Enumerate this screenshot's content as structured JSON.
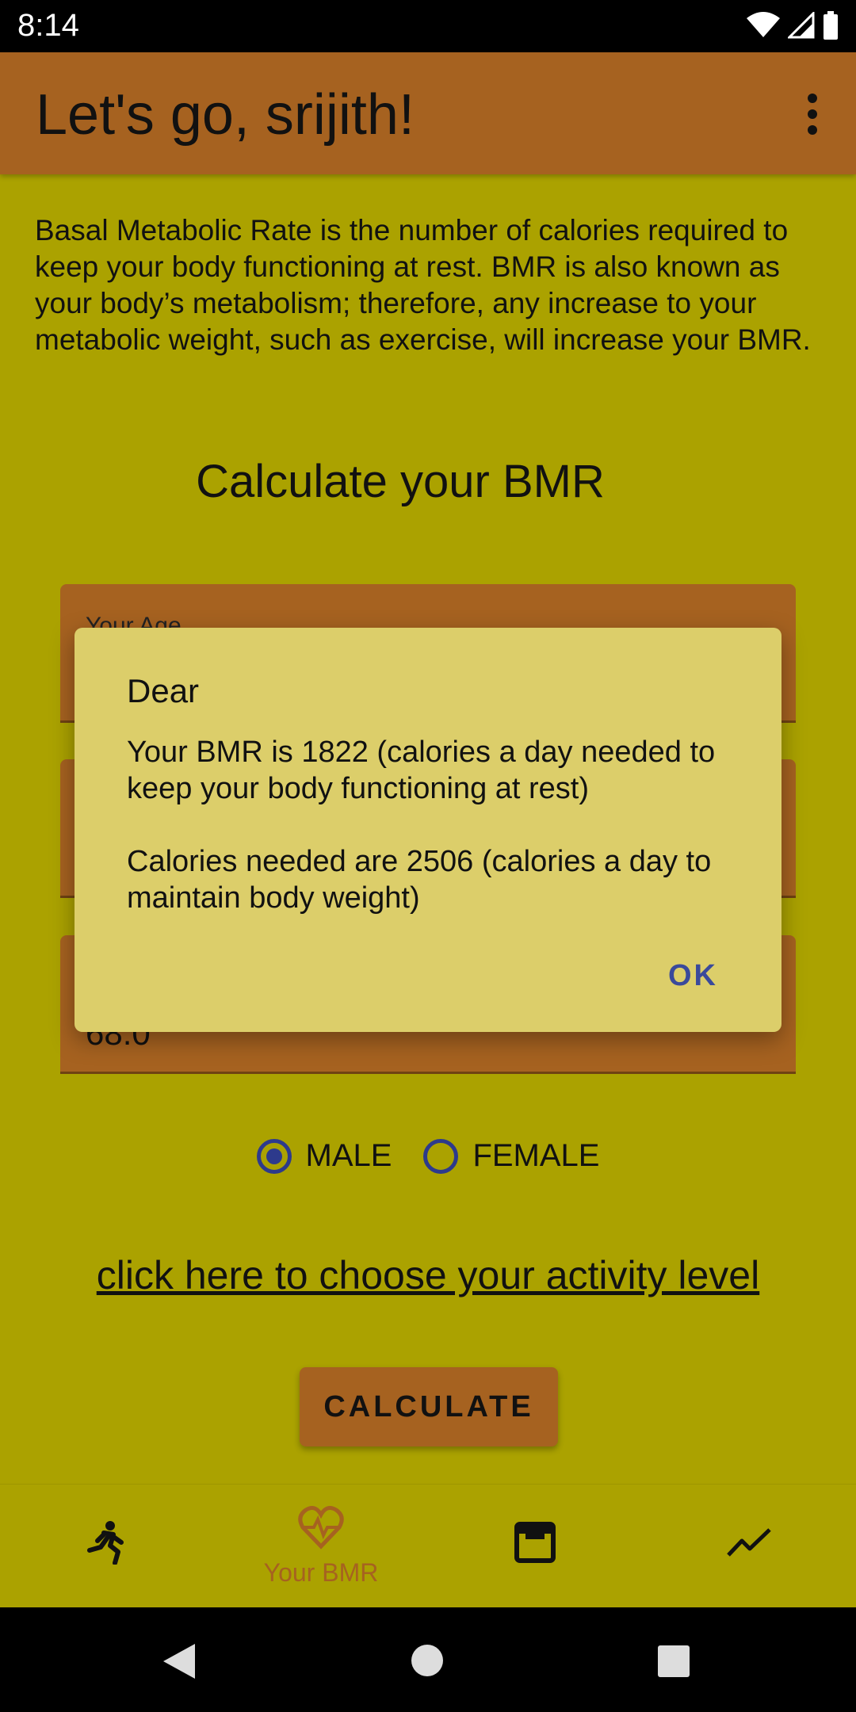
{
  "status_bar": {
    "time": "8:14"
  },
  "app_bar": {
    "title": "Let's go, srijith!"
  },
  "description": "Basal Metabolic Rate is the number of calories required to keep your body functioning at rest. BMR is also known as your body’s metabolism; therefore, any increase to your metabolic weight, such as exercise, will increase your BMR.",
  "section_title": "Calculate your BMR",
  "fields": [
    {
      "label": "Your Age",
      "value": ""
    },
    {
      "label": "",
      "value": ""
    },
    {
      "label": "",
      "value": "68.0"
    }
  ],
  "gender": {
    "male_label": "MALE",
    "female_label": "FEMALE",
    "selected": "MALE"
  },
  "activity_link": "click here to choose your activity level",
  "calculate_label": "CALCULATE",
  "bottom_nav": {
    "items": [
      {
        "icon": "running-icon",
        "label": ""
      },
      {
        "icon": "heart-pulse-icon",
        "label": "Your BMR"
      },
      {
        "icon": "calendar-icon",
        "label": ""
      },
      {
        "icon": "trend-icon",
        "label": ""
      }
    ]
  },
  "dialog": {
    "title": "Dear",
    "message": "Your BMR is 1822 (calories a day needed to keep your body functioning at rest)\n\nCalories needed are 2506 (calories a day to maintain body weight)",
    "ok_label": "OK"
  },
  "colors": {
    "background": "#aba200",
    "accent": "#a66220",
    "dialog": "#dcce6a",
    "radio": "#2d3a8c"
  }
}
